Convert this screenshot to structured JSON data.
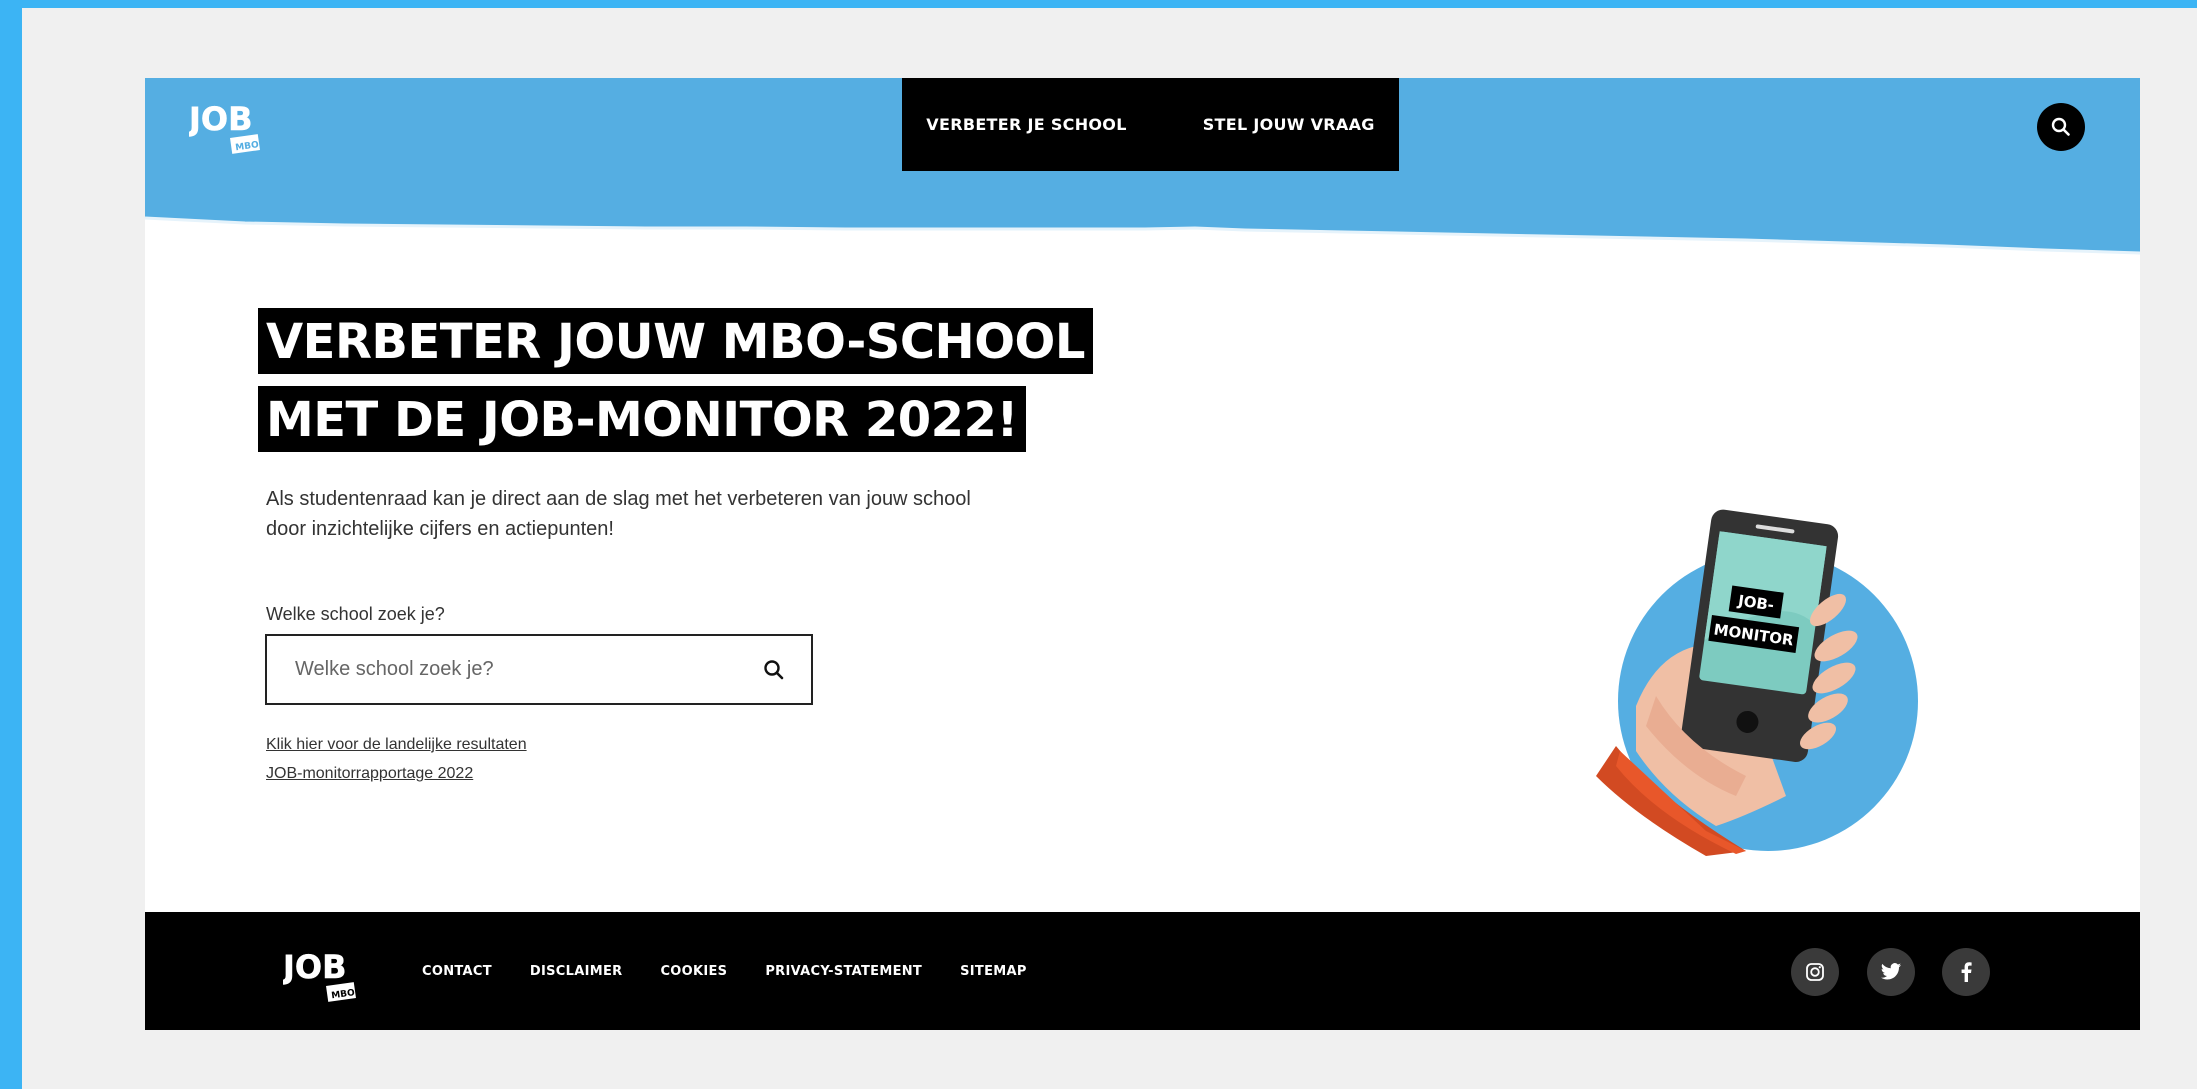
{
  "colors": {
    "frame": "#3cb4f4",
    "header_blue": "#55aee2",
    "background": "#f0f0f0",
    "black": "#000000"
  },
  "header": {
    "logo": {
      "main": "JOB",
      "tag": "MBO"
    },
    "nav": [
      "VERBETER JE SCHOOL",
      "STEL JOUW VRAAG"
    ],
    "search_icon": "search-icon"
  },
  "hero": {
    "title_line1": "VERBETER JOUW MBO-SCHOOL",
    "title_line2": "MET DE JOB-MONITOR 2022!",
    "intro": "Als studentenraad kan je direct aan de slag met het verbeteren van jouw school door inzichtelijke cijfers en actiepunten!",
    "search_label": "Welke school zoek je?",
    "search_placeholder": "Welke school zoek je?",
    "search_value": "",
    "links": [
      "Klik hier voor de landelijke resultaten",
      "JOB-monitorrapportage 2022"
    ],
    "phone_label": [
      "JOB-",
      "MONITOR"
    ]
  },
  "footer": {
    "logo": {
      "main": "JOB",
      "tag": "MBO"
    },
    "nav": [
      "CONTACT",
      "DISCLAIMER",
      "COOKIES",
      "PRIVACY-STATEMENT",
      "SITEMAP"
    ],
    "social": [
      "instagram-icon",
      "twitter-icon",
      "facebook-icon"
    ]
  }
}
